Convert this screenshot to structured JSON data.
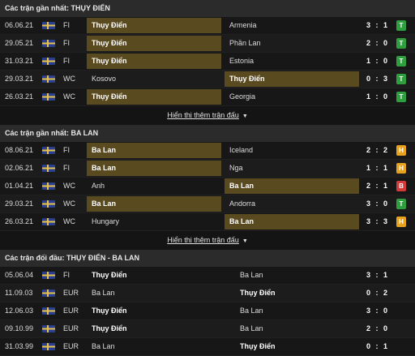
{
  "sections": [
    {
      "title": "Các trận gần nhất: THỤY ĐIỂN",
      "more_label": "Hiển thị thêm trận đấu",
      "rows": [
        {
          "date": "06.06.21",
          "comp": "FI",
          "home": "Thụy Điển",
          "away": "Armenia",
          "score": "3 : 1",
          "result": "T",
          "hl": "home"
        },
        {
          "date": "29.05.21",
          "comp": "FI",
          "home": "Thụy Điển",
          "away": "Phần Lan",
          "score": "2 : 0",
          "result": "T",
          "hl": "home"
        },
        {
          "date": "31.03.21",
          "comp": "FI",
          "home": "Thụy Điển",
          "away": "Estonia",
          "score": "1 : 0",
          "result": "T",
          "hl": "home"
        },
        {
          "date": "29.03.21",
          "comp": "WC",
          "home": "Kosovo",
          "away": "Thụy Điển",
          "score": "0 : 3",
          "result": "T",
          "hl": "away"
        },
        {
          "date": "26.03.21",
          "comp": "WC",
          "home": "Thụy Điển",
          "away": "Georgia",
          "score": "1 : 0",
          "result": "T",
          "hl": "home"
        }
      ]
    },
    {
      "title": "Các trận gần nhất: BA LAN",
      "more_label": "Hiển thị thêm trận đấu",
      "rows": [
        {
          "date": "08.06.21",
          "comp": "FI",
          "home": "Ba Lan",
          "away": "Iceland",
          "score": "2 : 2",
          "result": "H",
          "hl": "home"
        },
        {
          "date": "02.06.21",
          "comp": "FI",
          "home": "Ba Lan",
          "away": "Nga",
          "score": "1 : 1",
          "result": "H",
          "hl": "home"
        },
        {
          "date": "01.04.21",
          "comp": "WC",
          "home": "Anh",
          "away": "Ba Lan",
          "score": "2 : 1",
          "result": "B",
          "hl": "away"
        },
        {
          "date": "29.03.21",
          "comp": "WC",
          "home": "Ba Lan",
          "away": "Andorra",
          "score": "3 : 0",
          "result": "T",
          "hl": "home"
        },
        {
          "date": "26.03.21",
          "comp": "WC",
          "home": "Hungary",
          "away": "Ba Lan",
          "score": "3 : 3",
          "result": "H",
          "hl": "away"
        }
      ]
    }
  ],
  "h2h": {
    "title": "Các trận đối đầu: THỤY ĐIỂN - BA LAN",
    "rows": [
      {
        "date": "05.06.04",
        "comp": "FI",
        "home": "Thụy Điển",
        "away": "Ba Lan",
        "score": "3 : 1",
        "winner": "home"
      },
      {
        "date": "11.09.03",
        "comp": "EUR",
        "home": "Ba Lan",
        "away": "Thụy Điển",
        "score": "0 : 2",
        "winner": "away"
      },
      {
        "date": "12.06.03",
        "comp": "EUR",
        "home": "Thụy Điển",
        "away": "Ba Lan",
        "score": "3 : 0",
        "winner": "home"
      },
      {
        "date": "09.10.99",
        "comp": "EUR",
        "home": "Thụy Điển",
        "away": "Ba Lan",
        "score": "2 : 0",
        "winner": "home"
      },
      {
        "date": "31.03.99",
        "comp": "EUR",
        "home": "Ba Lan",
        "away": "Thụy Điển",
        "score": "0 : 1",
        "winner": "away"
      }
    ]
  },
  "colors": {
    "highlight": "#5a4a20",
    "win": "#2e9e3e",
    "draw": "#e6a21f",
    "loss": "#d43a3a"
  },
  "icons": {
    "competition": "league-flag-icon",
    "more": "caret-down-icon"
  }
}
